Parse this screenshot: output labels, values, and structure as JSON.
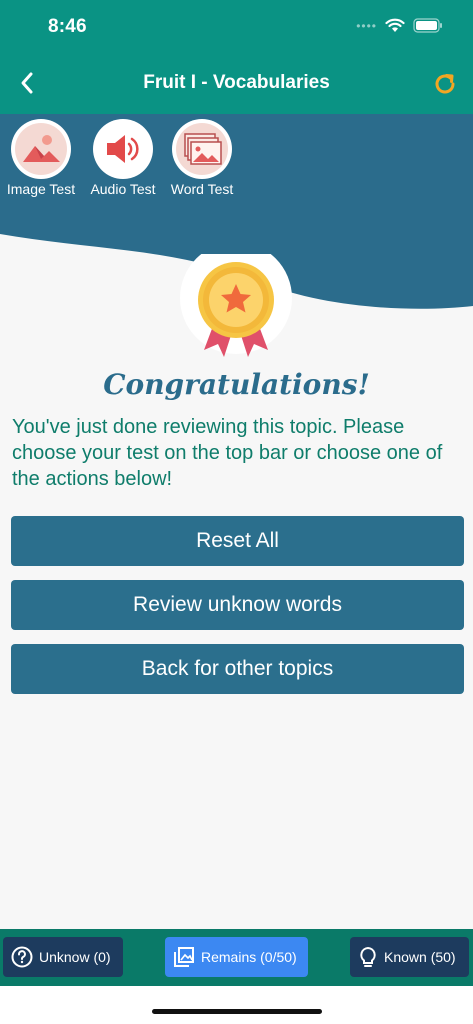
{
  "status_bar": {
    "time": "8:46"
  },
  "header": {
    "title": "Fruit I - Vocabularies",
    "bg_color": "#0a9384",
    "accent_color": "#f2a623"
  },
  "tests": [
    {
      "label": "Image Test",
      "icon": "image-icon"
    },
    {
      "label": "Audio Test",
      "icon": "speaker-icon"
    },
    {
      "label": "Word Test",
      "icon": "picture-stack-icon"
    }
  ],
  "main": {
    "congrats": "Congratulations!",
    "message": "You've just done reviewing this topic. Please choose your test on the top bar or choose one of the actions below!",
    "actions": [
      {
        "label": "Reset All"
      },
      {
        "label": "Review unknow words"
      },
      {
        "label": "Back for other topics"
      }
    ]
  },
  "bottom_bar": {
    "unknow": "Unknow (0)",
    "remains": "Remains (0/50)",
    "known": "Known (50)"
  },
  "colors": {
    "primary": "#0a9384",
    "wave": "#2b6c8c",
    "button": "#2b6f8d",
    "remains_button": "#3c88f2",
    "dark_button": "#1d3b5e"
  }
}
